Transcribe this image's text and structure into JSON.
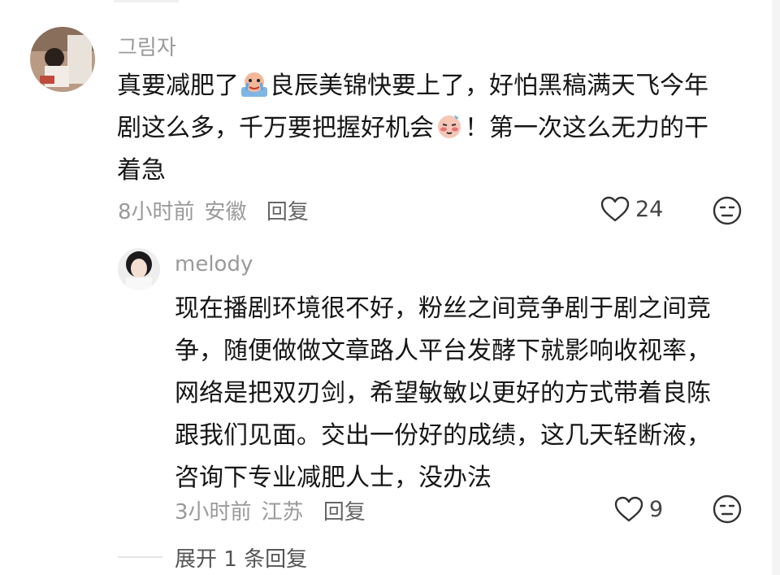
{
  "comment": {
    "username": "그림자",
    "text_line1a": "真要减肥了",
    "text_line1b": "良辰美锦快要上了，好怕黑稿满天飞今年",
    "text_line2a": "剧这么多，千万要把握好机会",
    "text_line2b": "！第一次这么无力的干",
    "text_line3": "着急",
    "time": "8小时前",
    "location": "安徽",
    "reply_label": "回复",
    "likes": "24",
    "emoji1": "crying-emoji",
    "emoji2": "blushing-emoji"
  },
  "reply": {
    "username": "melody",
    "lines": [
      "现在播剧环境很不好，粉丝之间竞争剧于剧之间竞",
      "争，随便做做文章路人平台发酵下就影响收视率，",
      "网络是把双刃剑，希望敏敏以更好的方式带着良陈",
      "跟我们见面。交出一份好的成绩，这几天轻断液，",
      "咨询下专业减肥人士，没办法"
    ],
    "time": "3小时前",
    "location": "江苏",
    "reply_label": "回复",
    "likes": "9"
  },
  "expand_label": "展开 1 条回复",
  "colors": {
    "meta": "#9a9a9a",
    "text": "#161616",
    "icon": "#333333"
  }
}
